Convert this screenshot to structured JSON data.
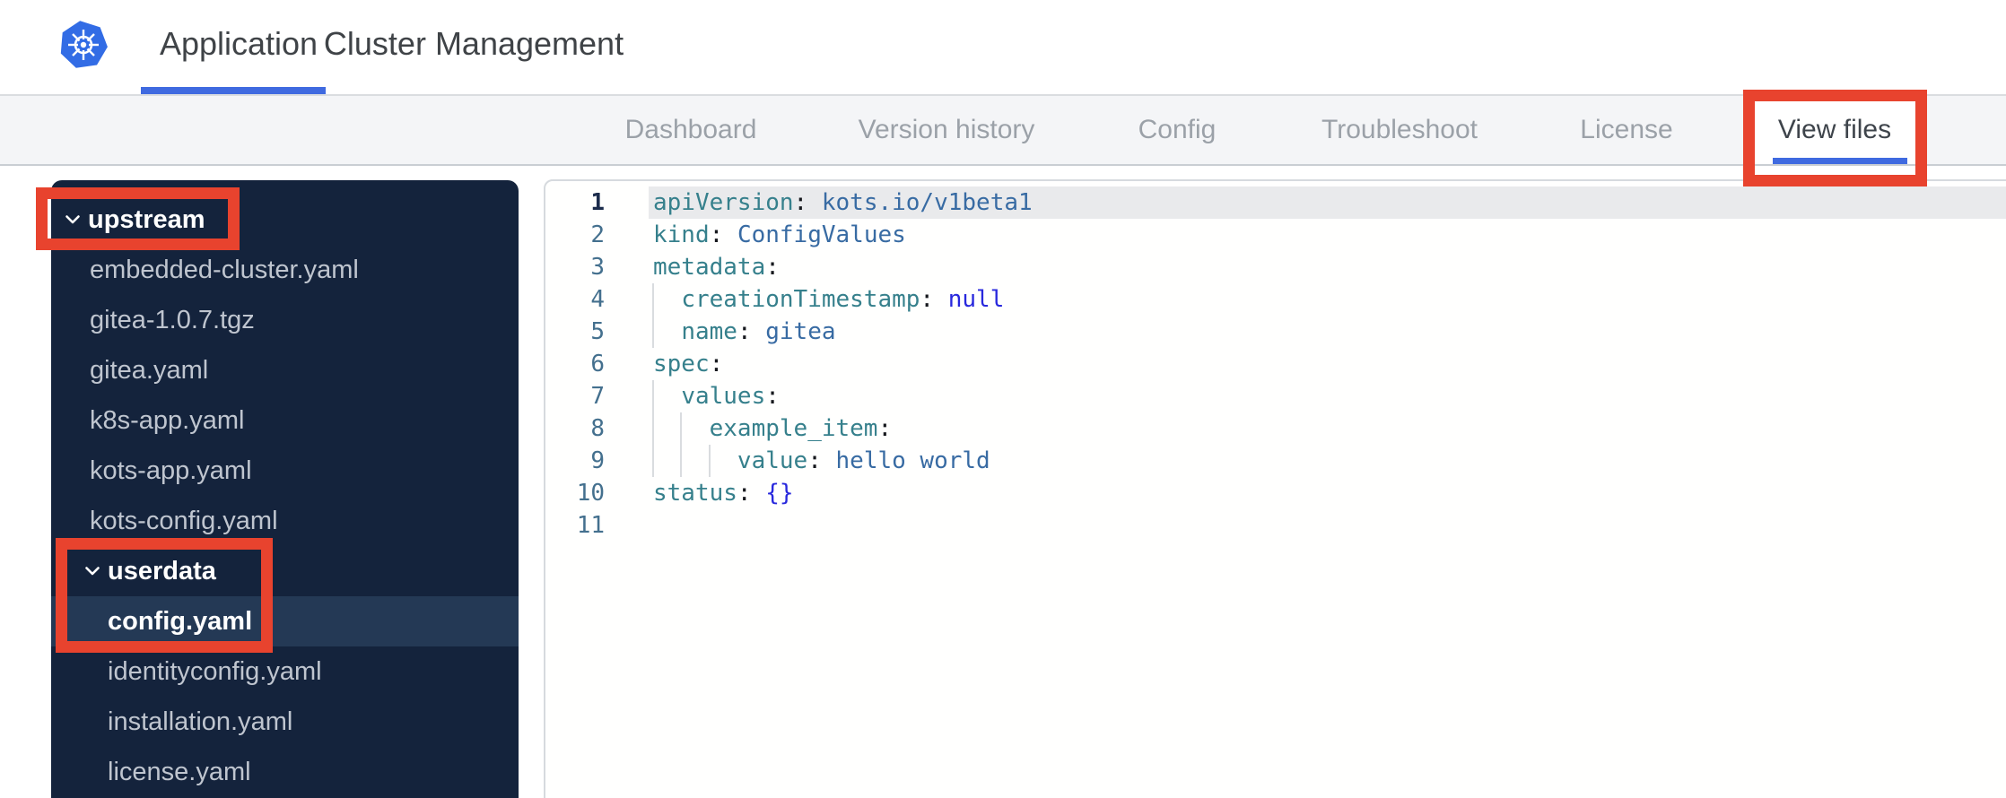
{
  "header": {
    "logo": "kubernetes-logo",
    "tabs": [
      {
        "label": "Application",
        "active": true
      },
      {
        "label": "Cluster Management",
        "active": false
      }
    ]
  },
  "nav": {
    "tabs": [
      {
        "label": "Dashboard",
        "active": false
      },
      {
        "label": "Version history",
        "active": false
      },
      {
        "label": "Config",
        "active": false
      },
      {
        "label": "Troubleshoot",
        "active": false
      },
      {
        "label": "License",
        "active": false
      },
      {
        "label": "View files",
        "active": true
      }
    ]
  },
  "sidebar": {
    "items": [
      {
        "type": "folder",
        "label": "upstream",
        "level": 1,
        "expanded": true,
        "annotated": true
      },
      {
        "type": "file",
        "label": "embedded-cluster.yaml",
        "level": 1
      },
      {
        "type": "file",
        "label": "gitea-1.0.7.tgz",
        "level": 1
      },
      {
        "type": "file",
        "label": "gitea.yaml",
        "level": 1
      },
      {
        "type": "file",
        "label": "k8s-app.yaml",
        "level": 1
      },
      {
        "type": "file",
        "label": "kots-app.yaml",
        "level": 1
      },
      {
        "type": "file",
        "label": "kots-config.yaml",
        "level": 1
      },
      {
        "type": "folder",
        "label": "userdata",
        "level": 2,
        "expanded": true,
        "annotated": true
      },
      {
        "type": "file",
        "label": "config.yaml",
        "level": 2,
        "selected": true,
        "annotated": true
      },
      {
        "type": "file",
        "label": "identityconfig.yaml",
        "level": 2
      },
      {
        "type": "file",
        "label": "installation.yaml",
        "level": 2
      },
      {
        "type": "file",
        "label": "license.yaml",
        "level": 2
      }
    ]
  },
  "editor": {
    "language": "yaml",
    "lines": [
      {
        "num": 1,
        "active": true,
        "guides": [],
        "tokens": [
          [
            "key",
            "apiVersion"
          ],
          [
            "colon",
            ": "
          ],
          [
            "str",
            "kots.io/v1beta1"
          ]
        ]
      },
      {
        "num": 2,
        "guides": [],
        "tokens": [
          [
            "key",
            "kind"
          ],
          [
            "colon",
            ": "
          ],
          [
            "str",
            "ConfigValues"
          ]
        ]
      },
      {
        "num": 3,
        "guides": [],
        "tokens": [
          [
            "key",
            "metadata"
          ],
          [
            "colon",
            ":"
          ]
        ]
      },
      {
        "num": 4,
        "guides": [
          0
        ],
        "tokens": [
          [
            "ws",
            "  "
          ],
          [
            "key",
            "creationTimestamp"
          ],
          [
            "colon",
            ": "
          ],
          [
            "kw",
            "null"
          ]
        ]
      },
      {
        "num": 5,
        "guides": [
          0
        ],
        "tokens": [
          [
            "ws",
            "  "
          ],
          [
            "key",
            "name"
          ],
          [
            "colon",
            ": "
          ],
          [
            "str",
            "gitea"
          ]
        ]
      },
      {
        "num": 6,
        "guides": [],
        "tokens": [
          [
            "key",
            "spec"
          ],
          [
            "colon",
            ":"
          ]
        ]
      },
      {
        "num": 7,
        "guides": [
          0
        ],
        "tokens": [
          [
            "ws",
            "  "
          ],
          [
            "key",
            "values"
          ],
          [
            "colon",
            ":"
          ]
        ]
      },
      {
        "num": 8,
        "guides": [
          0,
          2
        ],
        "tokens": [
          [
            "ws",
            "    "
          ],
          [
            "key",
            "example_item"
          ],
          [
            "colon",
            ":"
          ]
        ]
      },
      {
        "num": 9,
        "guides": [
          0,
          2,
          4
        ],
        "tokens": [
          [
            "ws",
            "      "
          ],
          [
            "key",
            "value"
          ],
          [
            "colon",
            ": "
          ],
          [
            "str",
            "hello world"
          ]
        ]
      },
      {
        "num": 10,
        "guides": [],
        "tokens": [
          [
            "key",
            "status"
          ],
          [
            "colon",
            ": "
          ],
          [
            "kw",
            "{}"
          ]
        ]
      },
      {
        "num": 11,
        "guides": [],
        "tokens": []
      }
    ]
  },
  "annotations": [
    {
      "target": "upstream-folder"
    },
    {
      "target": "userdata-config-yaml"
    },
    {
      "target": "view-files-tab"
    }
  ],
  "colors": {
    "accent_blue": "#3f6ae0",
    "annotation_red": "#e8432e",
    "nav_bg": "#f4f5f7",
    "sidebar_bg": "#14233c",
    "sidebar_selected": "#243955",
    "code_key": "#36808c",
    "code_string": "#386ba3",
    "code_keyword": "#2828dd",
    "logo_blue": "#326ce5"
  }
}
